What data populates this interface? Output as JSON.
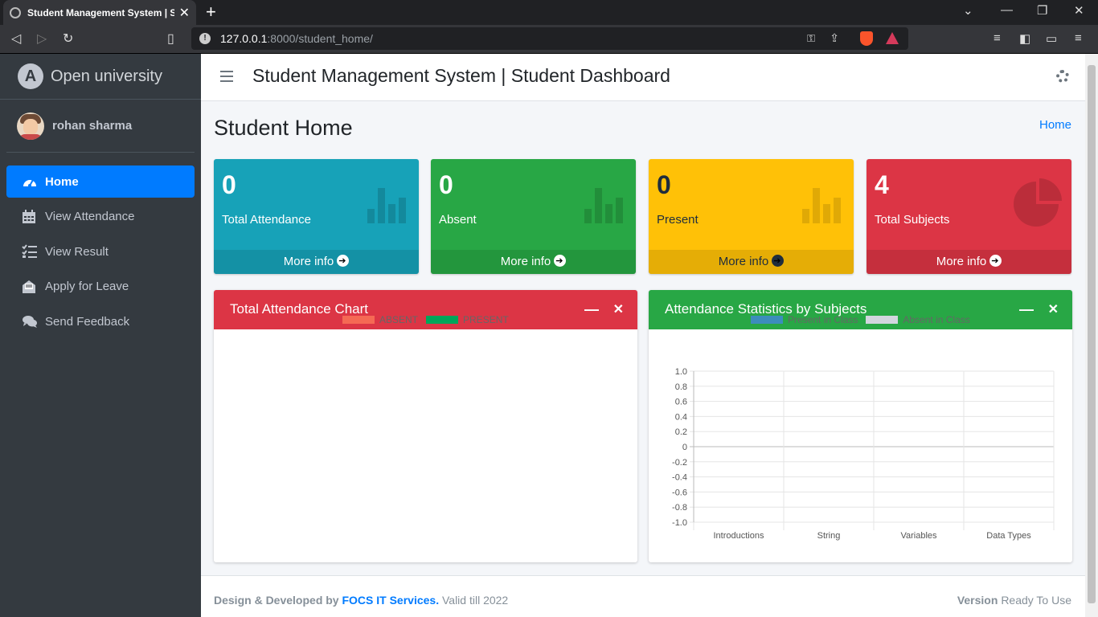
{
  "browser": {
    "tab_title": "Student Management System | Stu",
    "url_host": "127.0.0.1",
    "url_path": ":8000/student_home/"
  },
  "sidebar": {
    "brand": "Open university",
    "user_name": "rohan sharma",
    "items": [
      {
        "label": "Home",
        "icon": "dashboard-icon",
        "active": true
      },
      {
        "label": "View Attendance",
        "icon": "calendar-icon"
      },
      {
        "label": "View Result",
        "icon": "list-check-icon"
      },
      {
        "label": "Apply for Leave",
        "icon": "envelope-open-icon"
      },
      {
        "label": "Send Feedback",
        "icon": "comments-icon"
      }
    ]
  },
  "header": {
    "title": "Student Management System | Student Dashboard"
  },
  "content": {
    "title": "Student Home",
    "breadcrumb": "Home"
  },
  "stats": [
    {
      "value": "0",
      "label": "Total Attendance",
      "link": "More info",
      "color": "#17a2b8",
      "icon": "bar-chart-icon"
    },
    {
      "value": "0",
      "label": "Absent",
      "link": "More info",
      "color": "#28a745",
      "icon": "bar-chart-icon"
    },
    {
      "value": "0",
      "label": "Present",
      "link": "More info",
      "color": "#ffc107",
      "icon": "bar-chart-icon"
    },
    {
      "value": "4",
      "label": "Total Subjects",
      "link": "More info",
      "color": "#dc3545",
      "icon": "pie-chart-icon"
    }
  ],
  "cards": {
    "attendance": {
      "title": "Total Attendance Chart",
      "color": "#dc3545"
    },
    "subjects": {
      "title": "Attendance Statistics by Subjects",
      "color": "#28a745"
    }
  },
  "chart_data": [
    {
      "type": "pie",
      "title": "Total Attendance Chart",
      "series": [
        {
          "name": "ABSENT",
          "value": 0,
          "color": "#f56954"
        },
        {
          "name": "PRESENT",
          "value": 0,
          "color": "#00a65a"
        }
      ]
    },
    {
      "type": "bar",
      "title": "Attendance Statistics by Subjects",
      "categories": [
        "Introductions",
        "String",
        "Variables",
        "Data Types"
      ],
      "series": [
        {
          "name": "Present in Class",
          "values": [
            0,
            0,
            0,
            0
          ],
          "color": "#3c8dbc"
        },
        {
          "name": "Absent in Class",
          "values": [
            0,
            0,
            0,
            0
          ],
          "color": "#d2d6de"
        }
      ],
      "yticks": [
        "1.0",
        "0.8",
        "0.6",
        "0.4",
        "0.2",
        "0",
        "-0.2",
        "-0.4",
        "-0.6",
        "-0.8",
        "-1.0"
      ],
      "ylim": [
        -1,
        1
      ],
      "grid": true,
      "legend": "top"
    }
  ],
  "footer": {
    "left_prefix": "Design & Developed by",
    "company": "FOCS IT Services.",
    "valid": "Valid till 2022",
    "version_label": "Version",
    "version_value": "Ready To Use"
  }
}
